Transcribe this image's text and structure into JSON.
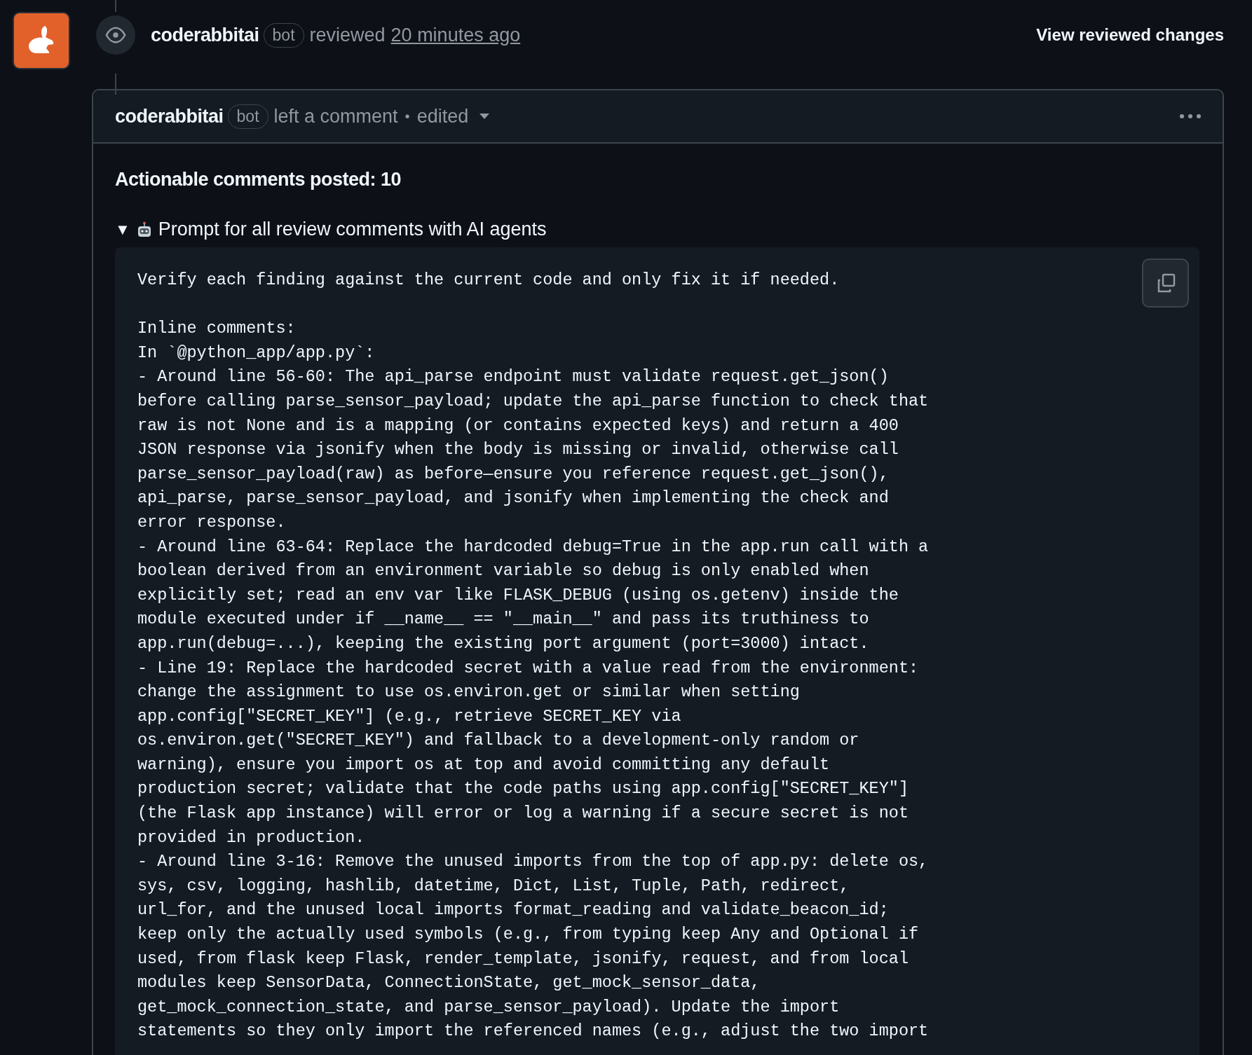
{
  "review": {
    "author": "coderabbitai",
    "badge": "bot",
    "action": "reviewed",
    "time": "20 minutes ago",
    "button": "View reviewed changes"
  },
  "comment": {
    "author": "coderabbitai",
    "badge": "bot",
    "action": "left a comment",
    "separator": "•",
    "edited": "edited",
    "heading": "Actionable comments posted: 10",
    "details": {
      "marker": "▼",
      "expanded": true,
      "summary": "Prompt for all review comments with AI agents",
      "blocks": [
        [
          "Verify each finding against the current code and only fix it if needed."
        ],
        [
          "Inline comments:",
          "In `@python_app/app.py`:",
          "- Around line 56-60: The api_parse endpoint must validate request.get_json()",
          "before calling parse_sensor_payload; update the api_parse function to check that",
          "raw is not None and is a mapping (or contains expected keys) and return a 400",
          "JSON response via jsonify when the body is missing or invalid, otherwise call",
          "parse_sensor_payload(raw) as before—ensure you reference request.get_json(),",
          "api_parse, parse_sensor_payload, and jsonify when implementing the check and",
          "error response.",
          "- Around line 63-64: Replace the hardcoded debug=True in the app.run call with a",
          "boolean derived from an environment variable so debug is only enabled when",
          "explicitly set; read an env var like FLASK_DEBUG (using os.getenv) inside the",
          "module executed under if __name__ == \"__main__\" and pass its truthiness to",
          "app.run(debug=...), keeping the existing port argument (port=3000) intact.",
          "- Line 19: Replace the hardcoded secret with a value read from the environment:",
          "change the assignment to use os.environ.get or similar when setting",
          "app.config[\"SECRET_KEY\"] (e.g., retrieve SECRET_KEY via",
          "os.environ.get(\"SECRET_KEY\") and fallback to a development-only random or",
          "warning), ensure you import os at top and avoid committing any default",
          "production secret; validate that the code paths using app.config[\"SECRET_KEY\"]",
          "(the Flask app instance) will error or log a warning if a secure secret is not",
          "provided in production.",
          "- Around line 3-16: Remove the unused imports from the top of app.py: delete os,",
          "sys, csv, logging, hashlib, datetime, Dict, List, Tuple, Path, redirect,",
          "url_for, and the unused local imports format_reading and validate_beacon_id;",
          "keep only the actually used symbols (e.g., from typing keep Any and Optional if",
          "used, from flask keep Flask, render_template, jsonify, request, and from local",
          "modules keep SensorData, ConnectionState, get_mock_sensor_data,",
          "get_mock_connection_state, and parse_sensor_payload). Update the import",
          "statements so they only import the referenced names (e.g., adjust the two import"
        ]
      ]
    }
  }
}
